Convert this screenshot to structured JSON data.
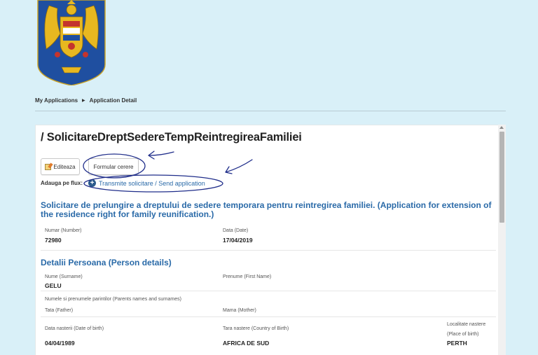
{
  "breadcrumb": {
    "items": [
      "My Applications",
      "Application Detail"
    ]
  },
  "page": {
    "title": "/ SolicitareDreptSedereTempReintregireaFamiliei"
  },
  "toolbar": {
    "edit_label": "Editeaza",
    "form_label": "Formular cerere"
  },
  "flow": {
    "label": "Adauga pe flux:",
    "action_label": "Transmite solicitare / Send application"
  },
  "application": {
    "heading": "Solicitare de prelungire a dreptului de sedere temporara pentru reintregirea familiei. (Application for extension of the residence right for family reunification.)",
    "number_label": "Numar (Number)",
    "number_value": "72980",
    "date_label": "Data (Date)",
    "date_value": "17/04/2019"
  },
  "person": {
    "heading": "Detalii Persoana (Person details)",
    "surname_label": "Nume (Surname)",
    "surname_value": "GELU",
    "firstname_label": "Prenume (First Name)",
    "parents_label": "Numele si prenumele parintilor (Parents names and surnames)",
    "father_label": "Tata (Father)",
    "mother_label": "Mama (Mother)",
    "dob_label": "Data nasterii (Date of birth)",
    "dob_value": "04/04/1989",
    "birth_country_label": "Tara nastere (Country of Birth)",
    "birth_country_value": "AFRICA DE SUD",
    "birth_place_label_1": "Localitate nastere",
    "birth_place_label_2": "(Place of birth)",
    "birth_place_value": "PERTH"
  },
  "colors": {
    "background": "#d9f0f8",
    "accent_blue": "#2a6aa8",
    "annotation_ink": "#1f2d8a",
    "crest_blue": "#1f4fa0",
    "crest_gold": "#e8b820"
  },
  "icons": {
    "edit": "pencil-note-icon",
    "add": "plus-circle-icon",
    "crumb_separator": "triangle-right-icon"
  }
}
